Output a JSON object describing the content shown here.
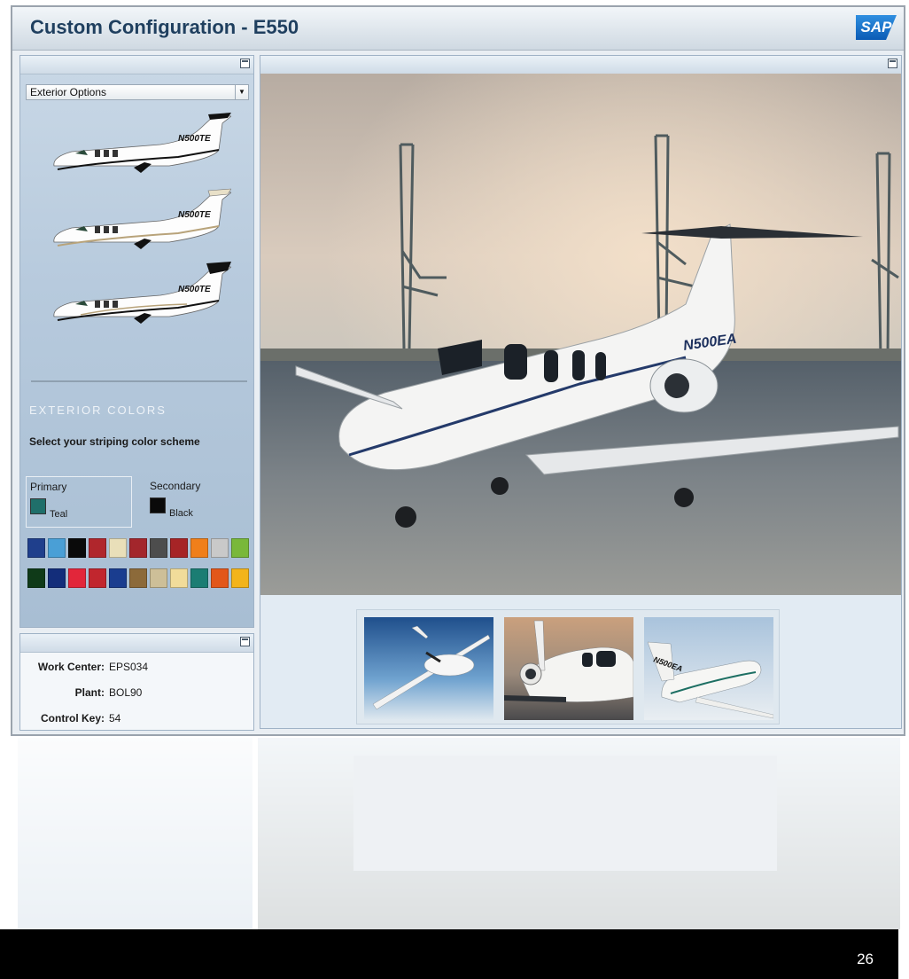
{
  "app": {
    "title": "Custom Configuration  - E550",
    "logo_text": "SAP"
  },
  "left_panel": {
    "dropdown_value": "Exterior Options",
    "options": [
      {
        "tail": "N500TE"
      },
      {
        "tail": "N500TE"
      },
      {
        "tail": "N500TE"
      }
    ],
    "section_title": "EXTERIOR COLORS",
    "section_subtitle": "Select your striping color scheme",
    "primary_label": "Primary",
    "primary_color_name": "Teal",
    "primary_color": "#1f6f6a",
    "secondary_label": "Secondary",
    "secondary_color_name": "Black",
    "secondary_color": "#0a0a0a",
    "palette_row1": [
      "#1f3f8c",
      "#4a9fd6",
      "#0a0a0a",
      "#b0262c",
      "#e9dfb9",
      "#a3262c",
      "#4d4d4d",
      "#a62426",
      "#f07f1a",
      "#c9c9c9",
      "#79b83a"
    ],
    "palette_row2": [
      "#0f3a18",
      "#132d7a",
      "#e2263a",
      "#c1262e",
      "#1a3d8f",
      "#8c6a3a",
      "#cdbf98",
      "#f1dc9a",
      "#1b7d73",
      "#e2571a",
      "#f3b41b"
    ]
  },
  "info_panel": {
    "work_center_label": "Work Center:",
    "work_center": "EPS034",
    "plant_label": "Plant:",
    "plant": "BOL90",
    "control_key_label": "Control Key:",
    "control_key": "54"
  },
  "main_image": {
    "tail_number": "N500EA"
  },
  "thumbnails": [
    {
      "name": "top-view"
    },
    {
      "name": "rear-view"
    },
    {
      "name": "flight-view",
      "tail": "N500EA"
    }
  ],
  "slide": {
    "page_number": "26"
  }
}
